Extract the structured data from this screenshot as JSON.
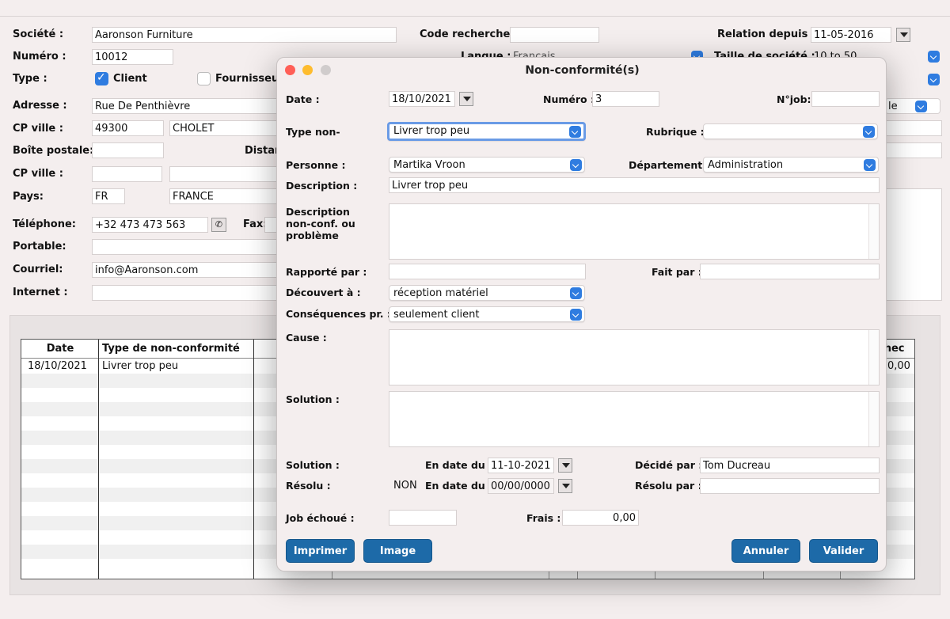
{
  "main": {
    "societe_label": "Société :",
    "societe_value": "Aaronson Furniture",
    "code_label": "Code recherche:",
    "relation_label": "Relation depuis :",
    "relation_value": "11-05-2016",
    "numero_label": "Numéro :",
    "numero_value": "10012",
    "langue_label": "Langue :",
    "langue_value": "Français",
    "taille_label": "Taille de société :",
    "taille_value": "10 to 50",
    "type_label": "Type :",
    "client_label": "Client",
    "fournisseur_label": "Fournisseu",
    "adresse_label": "Adresse :",
    "adresse_value": "Rue De Penthièvre",
    "adresse_right": "le",
    "cpville_label": "CP ville :",
    "cp_value": "49300",
    "ville_value": "CHOLET",
    "boite_label": "Boîte postale:",
    "distance_label": "Distar",
    "cpville2_label": "CP ville :",
    "pays_label": "Pays:",
    "pays_code": "FR",
    "pays_name": "FRANCE",
    "tel_label": "Téléphone:",
    "tel_value": "+32 473 473 563",
    "fax_label": "Fax:",
    "portable_label": "Portable:",
    "courriel_label": "Courriel:",
    "courriel_value": "info@Aaronson.com",
    "internet_label": "Internet :"
  },
  "table": {
    "headers": [
      "Date",
      "Type de non-conformité",
      "chec"
    ],
    "rows": [
      {
        "date": "18/10/2021",
        "type": "Livrer trop peu",
        "last": "0,00"
      }
    ]
  },
  "dialog": {
    "title": "Non-conformité(s)",
    "date_label": "Date :",
    "date_value": "18/10/2021",
    "numero_label": "Numéro :",
    "numero_value": "3",
    "njob_label": "N°job:",
    "typenon_label": "Type non-",
    "typenon_value": "Livrer trop peu",
    "rubrique_label": "Rubrique :",
    "personne_label": "Personne :",
    "personne_value": "Martika Vroon",
    "departement_label": "Département :",
    "departement_value": "Administration",
    "description_label": "Description :",
    "description_value": "Livrer trop peu",
    "desc_long_label_1": "Description",
    "desc_long_label_2": "non-conf. ou",
    "desc_long_label_3": "problème",
    "rapporte_label": "Rapporté par :",
    "faitpar_label": "Fait par :",
    "decouvert_label": "Découvert à :",
    "decouvert_value": "réception matériel",
    "consequences_label": "Conséquences pr. :",
    "consequences_value": "seulement client",
    "cause_label": "Cause :",
    "solution_label": "Solution :",
    "solution2_label": "Solution :",
    "endate_label": "En date du :",
    "endate_value": "11-10-2021",
    "decide_label": "Décidé par :",
    "decide_value": "Tom Ducreau",
    "resolu_label": "Résolu :",
    "resolu_value": "NON",
    "endate2_label": "En date du :",
    "endate2_value": "00/00/0000",
    "resolupar_label": "Résolu par :",
    "jobechoue_label": "Job échoué :",
    "frais_label": "Frais :",
    "frais_value": "0,00",
    "btn_imprimer": "Imprimer",
    "btn_image": "Image",
    "btn_annuler": "Annuler",
    "btn_valider": "Valider"
  },
  "colors": {
    "accent": "#2f7ce0",
    "button": "#1d6aa8",
    "traffic_red": "#ff5f57",
    "traffic_yellow": "#febc2e",
    "traffic_gray": "#d0cccc"
  }
}
